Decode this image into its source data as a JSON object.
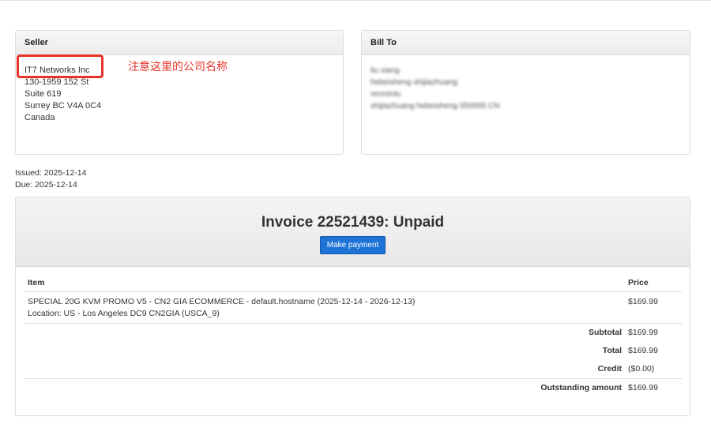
{
  "seller": {
    "header": "Seller",
    "lines": [
      "IT7 Networks Inc",
      "130-1959 152 St",
      "Suite 619",
      "Surrey BC V4A 0C4",
      "Canada"
    ]
  },
  "annotation": {
    "text": "注意这里的公司名称",
    "color": "#e8332a"
  },
  "bill_to": {
    "header": "Bill To",
    "lines": [
      "liu xiang",
      "hebeisheng shijiazhuang",
      "renminlu",
      "shijiazhuang hebeisheng 050000 CN"
    ]
  },
  "dates": {
    "issued": "Issued: 2025-12-14",
    "due": "Due: 2025-12-14"
  },
  "invoice": {
    "title": "Invoice 22521439: Unpaid",
    "pay_button": "Make payment",
    "accent": "#1e73d6",
    "columns": {
      "item": "Item",
      "price": "Price"
    },
    "item": {
      "description": "SPECIAL 20G KVM PROMO V5 - CN2 GIA ECOMMERCE - default.hostname (2025-12-14 - 2026-12-13)",
      "location": "Location: US - Los Angeles DC9 CN2GIA (USCA_9)",
      "price": "$169.99"
    },
    "summary": {
      "subtotal_label": "Subtotal",
      "subtotal": "$169.99",
      "total_label": "Total",
      "total": "$169.99",
      "credit_label": "Credit",
      "credit": "($0.00)",
      "outstanding_label": "Outstanding amount",
      "outstanding": "$169.99"
    }
  }
}
